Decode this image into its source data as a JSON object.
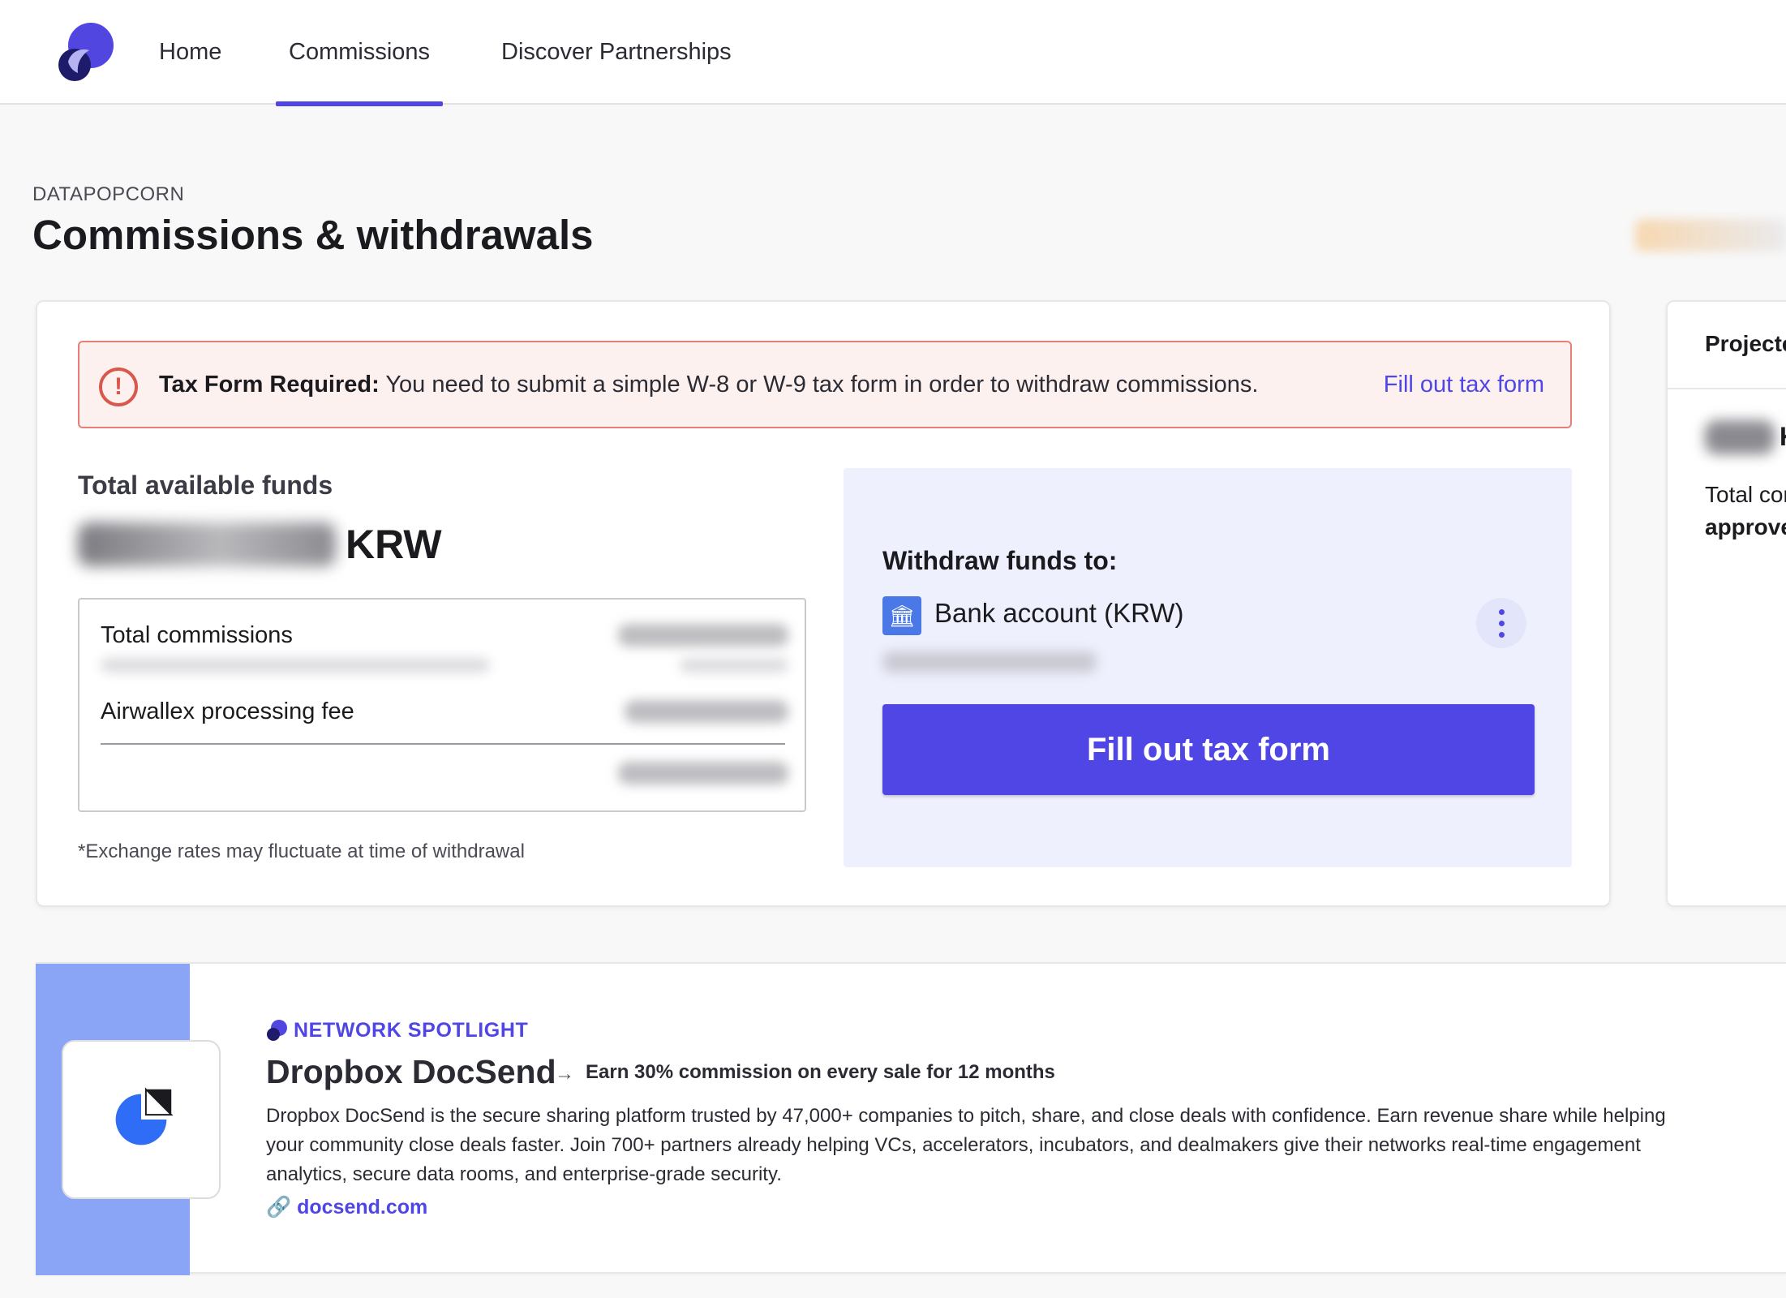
{
  "nav": {
    "tabs": [
      {
        "label": "Home"
      },
      {
        "label": "Commissions",
        "active": true
      },
      {
        "label": "Discover Partnerships"
      }
    ],
    "accent_color": "#4f46e5"
  },
  "header": {
    "eyebrow": "DATAPOPCORN",
    "title": "Commissions & withdrawals"
  },
  "alert": {
    "title": "Tax Form Required:",
    "message": "You need to submit a simple W-8 or W-9 tax form in order to withdraw commissions.",
    "link": "Fill out tax form",
    "icon": "alert-circle-icon",
    "color": "#d9584d"
  },
  "funds": {
    "label": "Total available funds",
    "currency": "KRW",
    "summary": {
      "rows": [
        {
          "label": "Total commissions"
        },
        {
          "label": "Airwallex processing fee"
        }
      ]
    },
    "note": "*Exchange rates may fluctuate at time of withdrawal"
  },
  "withdraw": {
    "title": "Withdraw funds to:",
    "method": "Bank account (KRW)",
    "method_icon": "bank-icon",
    "button": "Fill out tax form"
  },
  "side_card": {
    "title": "Projected",
    "unit": "K",
    "line1": "Total commissions",
    "line2": "approved"
  },
  "spotlight": {
    "eyebrow": "NETWORK SPOTLIGHT",
    "title": "Dropbox DocSend",
    "tagline": "Earn 30% commission on every sale for 12 months",
    "description": "Dropbox DocSend is the secure sharing platform trusted by 47,000+ companies to pitch, share, and close deals with confidence. Earn revenue share while helping your community close deals faster. Join 700+ partners already helping VCs, accelerators, incubators, and dealmakers give their networks real-time engagement analytics, secure data rooms, and enterprise-grade security.",
    "link": "docsend.com",
    "band_color": "#8aa4f6"
  }
}
